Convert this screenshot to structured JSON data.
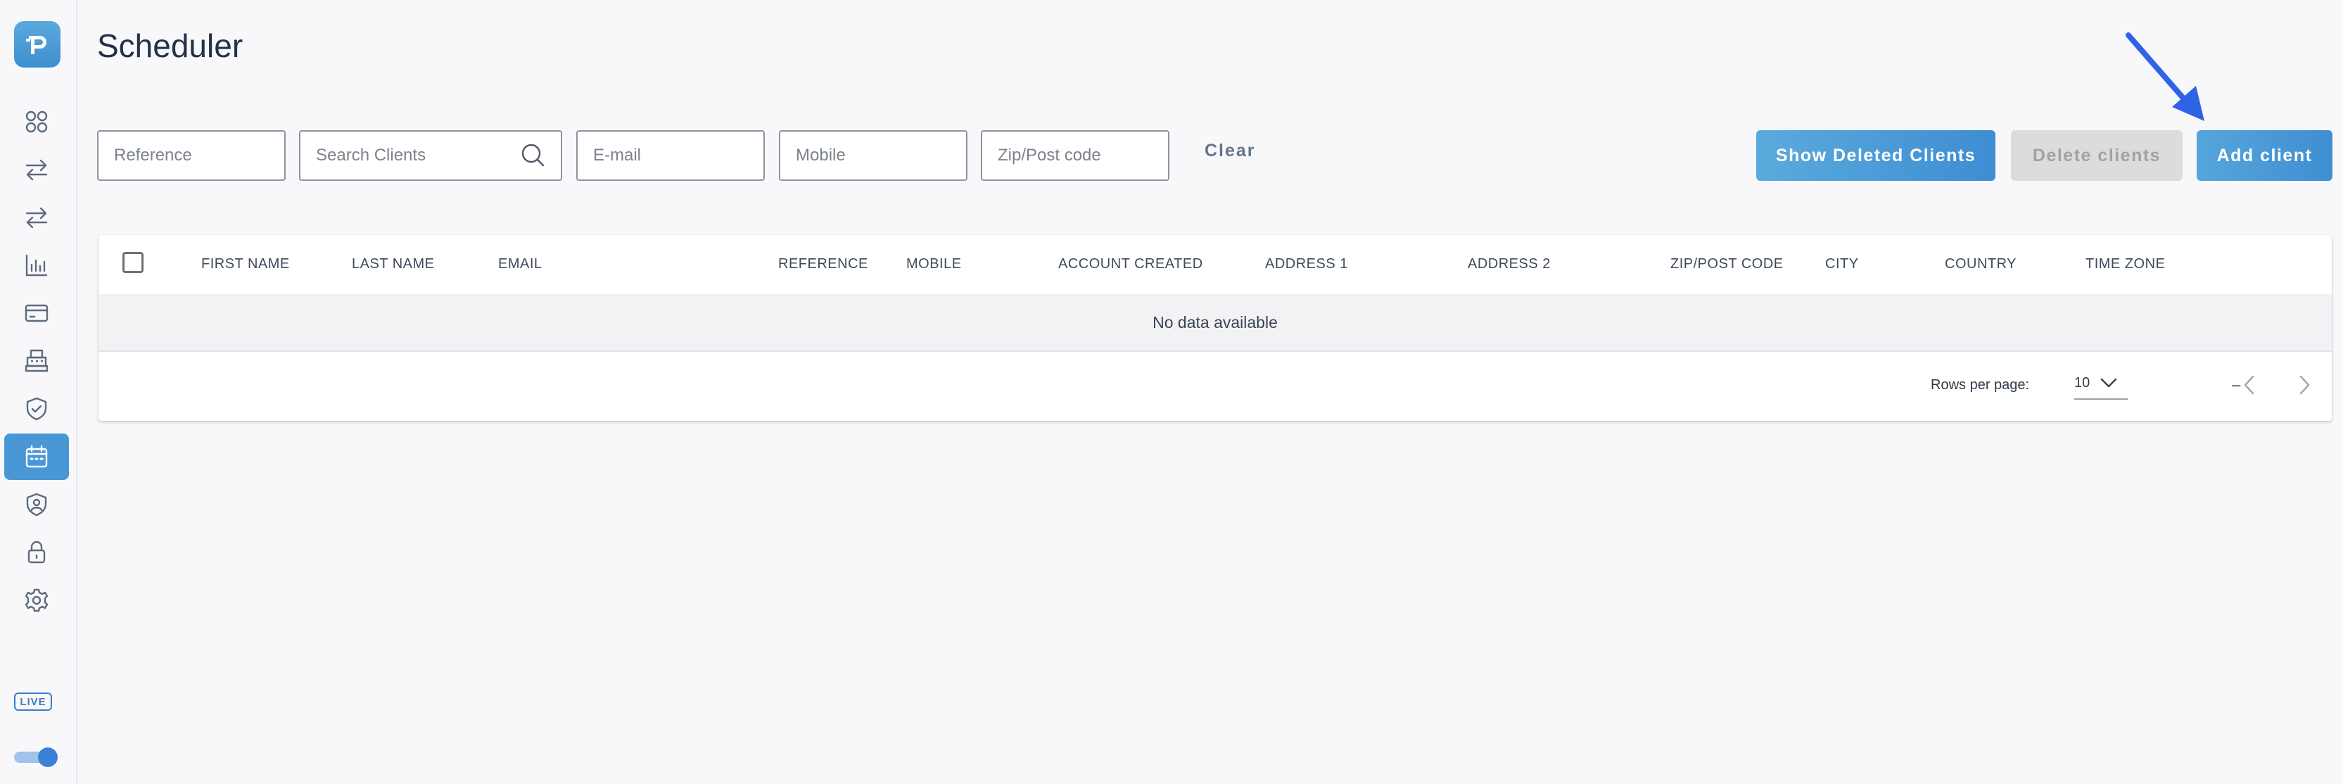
{
  "app": {
    "title": "Scheduler",
    "live_label": "LIVE"
  },
  "sidebar": {
    "items": [
      {
        "icon": "grid-icon"
      },
      {
        "icon": "transfer-icon"
      },
      {
        "icon": "exchange-icon"
      },
      {
        "icon": "bar-chart-icon"
      },
      {
        "icon": "credit-card-icon"
      },
      {
        "icon": "pos-terminal-icon"
      },
      {
        "icon": "shield-check-icon"
      },
      {
        "icon": "calendar-icon",
        "active": true
      },
      {
        "icon": "shield-user-icon"
      },
      {
        "icon": "lock-icon"
      },
      {
        "icon": "gear-icon"
      }
    ]
  },
  "filters": {
    "reference_placeholder": "Reference",
    "search_placeholder": "Search Clients",
    "email_placeholder": "E-mail",
    "mobile_placeholder": "Mobile",
    "zip_placeholder": "Zip/Post code",
    "clear_label": "Clear"
  },
  "actions": {
    "show_deleted_label": "Show Deleted Clients",
    "delete_label": "Delete clients",
    "add_label": "Add client"
  },
  "table": {
    "columns": [
      "FIRST NAME",
      "LAST NAME",
      "EMAIL",
      "REFERENCE",
      "MOBILE",
      "ACCOUNT CREATED",
      "ADDRESS 1",
      "ADDRESS 2",
      "ZIP/POST CODE",
      "CITY",
      "COUNTRY",
      "TIME ZONE"
    ],
    "empty_text": "No data available",
    "rows_per_page_label": "Rows per page:",
    "rows_per_page_value": "10",
    "range_text": "–"
  },
  "colors": {
    "accent": "#4a97d6",
    "annotation_arrow": "#2f63e6"
  }
}
